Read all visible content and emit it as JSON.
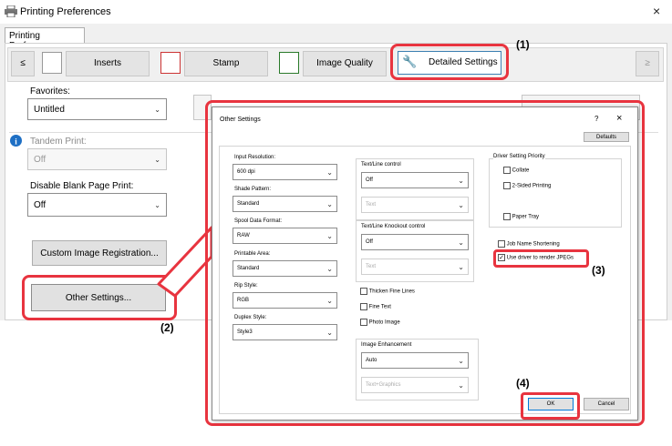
{
  "window": {
    "title": "Printing Preferences",
    "tab": "Printing Preferences",
    "close": "×"
  },
  "toolbar": {
    "prev": "≤",
    "inserts": "Inserts",
    "stamp": "Stamp",
    "image_quality": "Image Quality",
    "detailed": "Detailed Settings",
    "next": "≥"
  },
  "left": {
    "favorites_label": "Favorites:",
    "favorites_value": "Untitled",
    "tandem_label": "Tandem Print:",
    "tandem_value": "Off",
    "blank_label": "Disable Blank Page Print:",
    "blank_value": "Off",
    "custom_btn": "Custom Image Registration...",
    "other_btn": "Other Settings..."
  },
  "dialog": {
    "title": "Other Settings",
    "help": "?",
    "close": "×",
    "defaults": "Defaults",
    "input_res_label": "Input Resolution:",
    "input_res": "600 dpi",
    "shade_label": "Shade Pattern:",
    "shade": "Standard",
    "spool_label": "Spool Data Format:",
    "spool": "RAW",
    "printable_label": "Printable Area:",
    "printable": "Standard",
    "rip_label": "Rip Style:",
    "rip": "RGB",
    "duplex_label": "Duplex Style:",
    "duplex": "Style3",
    "textline_label": "Text/Line control",
    "textline": "Off",
    "text1": "Text",
    "knockout_label": "Text/Line Knockout control",
    "knockout": "Off",
    "text2": "Text",
    "thicken": "Thicken Fine Lines",
    "fine": "Fine Text",
    "photo": "Photo Image",
    "enh_label": "Image Enhancement",
    "enh": "Auto",
    "enh2": "Text+Graphics",
    "priority_label": "Driver Setting Priority",
    "collate": "Collate",
    "two_sided": "2-Sided Printing",
    "paper_tray": "Paper Tray",
    "job_name": "Job Name Shortening",
    "jpeg": "Use driver to render JPEGs",
    "ok": "OK",
    "cancel": "Cancel"
  },
  "callouts": {
    "c1": "(1)",
    "c2": "(2)",
    "c3": "(3)",
    "c4": "(4)"
  },
  "colors": {
    "accent": "#e8343f"
  }
}
